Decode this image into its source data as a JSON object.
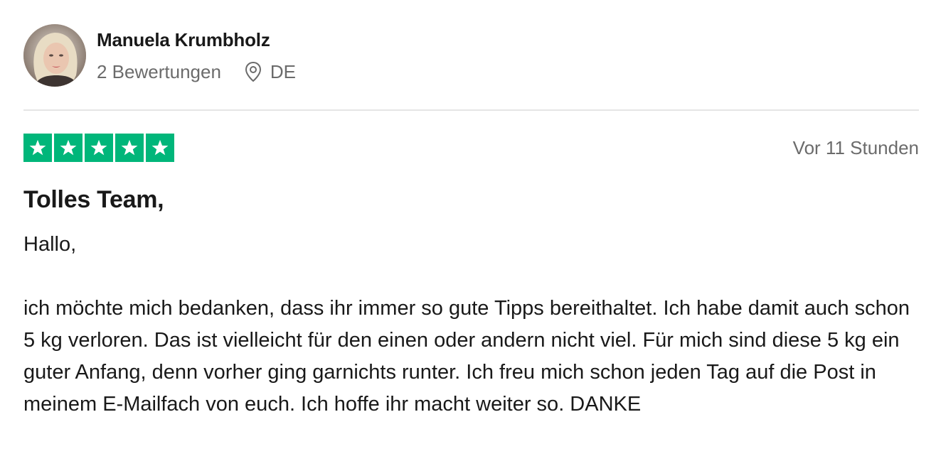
{
  "review": {
    "author": {
      "name": "Manuela Krumbholz",
      "review_count": "2 Bewertungen",
      "country": "DE",
      "avatar_icon": "user-photo"
    },
    "rating": {
      "stars": 5,
      "max": 5,
      "color": "#00b67a",
      "star_icon": "star-icon"
    },
    "date": "Vor 11 Stunden",
    "title": "Tolles Team,",
    "greeting": "Hallo,",
    "body": "ich möchte mich bedanken, dass ihr immer so gute Tipps bereithaltet. Ich habe damit auch schon 5 kg verloren. Das ist vielleicht für den einen oder andern nicht viel. Für mich sind diese 5 kg ein guter Anfang, denn vorher ging garnichts runter. Ich freu mich schon jeden Tag auf die Post in meinem E-Mailfach von euch. Ich hoffe ihr macht weiter so. DANKE"
  }
}
